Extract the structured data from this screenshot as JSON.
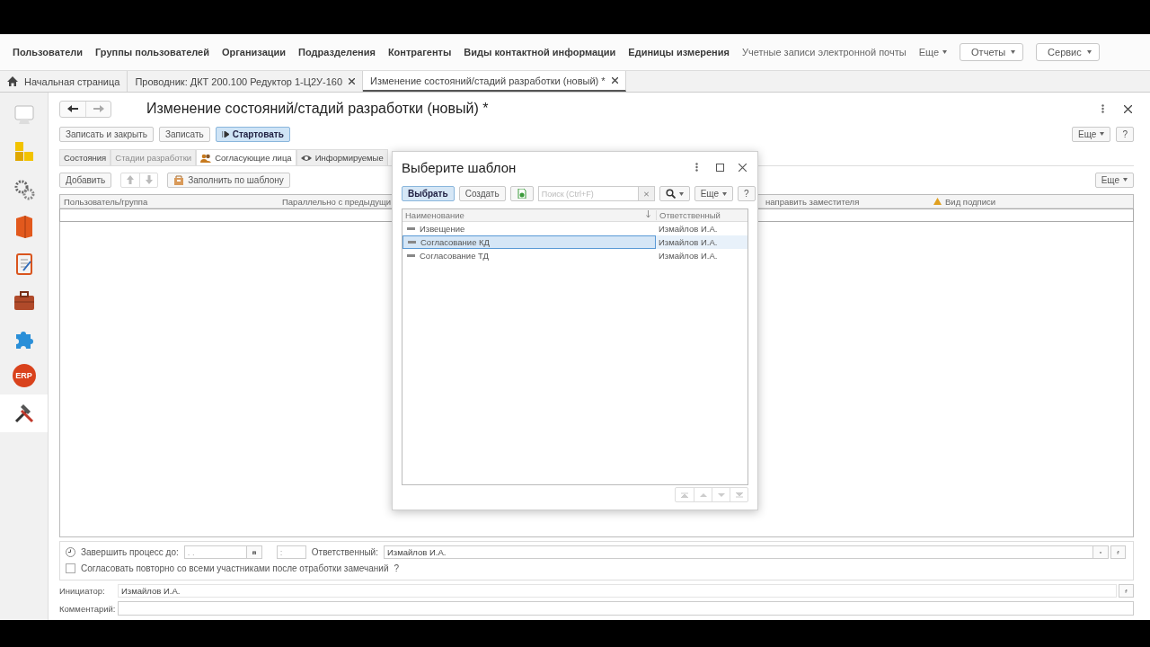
{
  "menu": {
    "items": [
      {
        "label": "Пользователи",
        "kind": "bold"
      },
      {
        "label": "Группы пользователей",
        "kind": "bold"
      },
      {
        "label": "Организации",
        "kind": "bold"
      },
      {
        "label": "Подразделения",
        "kind": "bold"
      },
      {
        "label": "Контрагенты",
        "kind": "bold"
      },
      {
        "label": "Виды контактной информации",
        "kind": "bold"
      },
      {
        "label": "Единицы измерения",
        "kind": "bold"
      },
      {
        "label": "Учетные записи электронной почты",
        "kind": "plain"
      }
    ],
    "more": "Еще",
    "buttons": [
      "Отчеты",
      "Сервис"
    ]
  },
  "tabs": [
    {
      "label": "Начальная страница",
      "kind": "home",
      "selected": false
    },
    {
      "label": "Проводник: ДКТ 200.100 Редуктор 1-Ц2У-160",
      "kind": "closable",
      "selected": false
    },
    {
      "label": "Изменение состояний/стадий разработки (новый) *",
      "kind": "closable",
      "selected": true
    }
  ],
  "sidebar": {
    "items": [
      {
        "kind": "monitor",
        "selected": false
      },
      {
        "kind": "blocks",
        "selected": false
      },
      {
        "kind": "gears",
        "selected": false
      },
      {
        "kind": "book",
        "selected": false
      },
      {
        "kind": "notepad",
        "selected": false
      },
      {
        "kind": "briefcase",
        "selected": false
      },
      {
        "kind": "puzzle",
        "selected": false
      },
      {
        "kind": "badge",
        "label": "ERP",
        "selected": false
      },
      {
        "kind": "tools",
        "selected": true
      }
    ]
  },
  "form": {
    "title": "Изменение состояний/стадий разработки (новый) *",
    "commands": [
      {
        "label": "Записать и закрыть",
        "kind": "plain"
      },
      {
        "label": "Записать",
        "kind": "plain"
      },
      {
        "label": "Стартовать",
        "kind": "primary"
      }
    ],
    "more": "Еще",
    "help": "?",
    "tabs": [
      {
        "label": "Состояния",
        "kind": "plain",
        "selected": false,
        "disabled": false
      },
      {
        "label": "Стадии разработки",
        "kind": "plain",
        "selected": false,
        "disabled": true
      },
      {
        "label": "Согласующие лица",
        "kind": "people",
        "selected": true,
        "disabled": false
      },
      {
        "label": "Информируемые",
        "kind": "watch",
        "selected": false,
        "disabled": false
      }
    ],
    "toolbar": {
      "add": "Добавить",
      "fill": "Заполнить по шаблону",
      "more": "Еще"
    },
    "columns": [
      {
        "label": "Пользователь/группа",
        "kind": "plain"
      },
      {
        "label": "Параллельно с предыдущи",
        "kind": "plain"
      },
      {
        "label": "направить заместителя",
        "kind": "plain"
      },
      {
        "label": "Вид подписи",
        "kind": "marked"
      }
    ],
    "deadline_label": "Завершить процесс до:",
    "date_value": ". .",
    "time_value": ":",
    "responsible_label": "Ответственный:",
    "responsible_value": "Измайлов И.А.",
    "repeat": {
      "label": "Согласовать повторно со всеми участниками после отработки замечаний",
      "checked": false
    },
    "repeat_help": "?",
    "initiator_label": "Инициатор:",
    "initiator_value": "Измайлов И.А.",
    "comment_label": "Комментарий:"
  },
  "dialog": {
    "title": "Выберите шаблон",
    "select": "Выбрать",
    "create": "Создать",
    "search_placeholder": "Поиск (Ctrl+F)",
    "more": "Еще",
    "help": "?",
    "columns": [
      "Наименование",
      "Ответственный"
    ],
    "rows": [
      {
        "name": "Извещение",
        "responsible": "Измайлов И.А.",
        "selected": false
      },
      {
        "name": "Согласование КД",
        "responsible": "Измайлов И.А.",
        "selected": true
      },
      {
        "name": "Согласование ТД",
        "responsible": "Измайлов И.А.",
        "selected": false
      }
    ]
  }
}
